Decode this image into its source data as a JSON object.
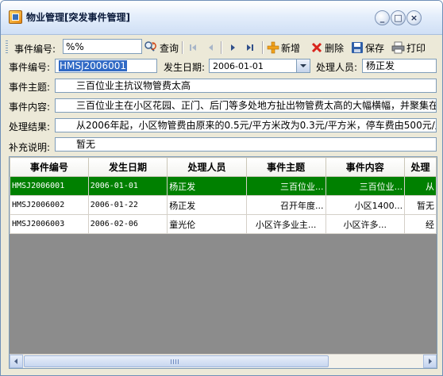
{
  "window": {
    "title": "物业管理[突发事件管理]"
  },
  "title_buttons": {
    "minimize": "_",
    "maximize": "□",
    "close": "×"
  },
  "toolbar": {
    "event_no_label": "事件编号:",
    "search_value": "%%",
    "query_label": "查询",
    "new_label": "新增",
    "delete_label": "删除",
    "save_label": "保存",
    "print_label": "打印"
  },
  "form": {
    "event_no_label": "事件编号:",
    "event_no_value": "HMSJ2006001",
    "date_label": "发生日期:",
    "date_value": "2006-01-01",
    "handler_label": "处理人员:",
    "handler_value": "杨正发",
    "subject_label": "事件主题:",
    "subject_value": "三百位业主抗议物管费太高",
    "content_label": "事件内容:",
    "content_value": "三百位业主在小区花园、正门、后门等多处地方扯出物管费太高的大幅横幅，并聚集在",
    "result_label": "处理结果:",
    "result_value": "从2006年起，小区物管费由原来的0.5元/平方米改为0.3元/平方米，停车费由500元/月",
    "notes_label": "补充说明:",
    "notes_value": "暂无"
  },
  "grid": {
    "headers": [
      "事件编号",
      "发生日期",
      "处理人员",
      "事件主题",
      "事件内容",
      "处理"
    ],
    "rows": [
      [
        "HMSJ2006001",
        "2006-01-01",
        "杨正发",
        "三百位业...",
        "三百位业...",
        "从"
      ],
      [
        "HMSJ2006002",
        "2006-01-22",
        "杨正发",
        "召开年度...",
        "小区1400...",
        "暂无"
      ],
      [
        "HMSJ2006003",
        "2006-02-06",
        "童光伦",
        "小区许多业主...",
        "小区许多...",
        "经"
      ]
    ],
    "selected_row": 0
  },
  "colors": {
    "selected_row": "#008000",
    "selection_highlight": "#316ac5",
    "window_bg": "#ece9d8"
  }
}
